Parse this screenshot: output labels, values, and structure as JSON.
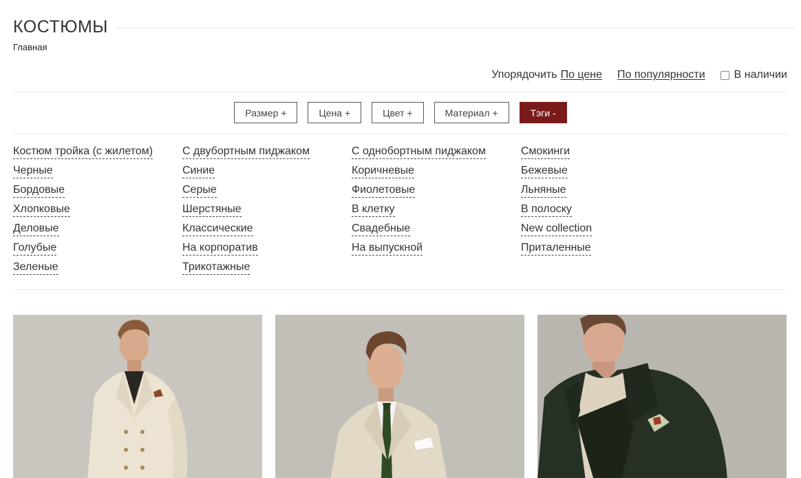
{
  "page": {
    "title": "КОСТЮМЫ",
    "breadcrumb": "Главная"
  },
  "sort": {
    "label": "Упорядочить",
    "by_price": "По цене",
    "by_popularity": "По популярности",
    "in_stock": "В наличии"
  },
  "filters": [
    {
      "label": "Размер +"
    },
    {
      "label": "Цена +"
    },
    {
      "label": "Цвет +"
    },
    {
      "label": "Материал +"
    },
    {
      "label": "Тэги -"
    }
  ],
  "tags": {
    "col1": [
      "Костюм тройка (с жилетом)",
      "Черные",
      "Бордовые",
      "Хлопковые",
      "Деловые",
      "Голубые",
      "Зеленые"
    ],
    "col2": [
      "С двубортным пиджаком",
      "Синие",
      "Серые",
      "Шерстяные",
      "Классические",
      "На корпоратив",
      "Трикотажные"
    ],
    "col3": [
      "С однобортным пиджаком",
      "Коричневые",
      "Фиолетовые",
      "В клетку",
      "Свадебные",
      "На выпускной"
    ],
    "col4": [
      "Смокинги",
      "Бежевые",
      "Льняные",
      "В полоску",
      "New collection",
      "Приталенные"
    ]
  },
  "colors": {
    "accent": "#7a1b1b",
    "text": "#333333",
    "product_bg": "#c4c0ba"
  }
}
